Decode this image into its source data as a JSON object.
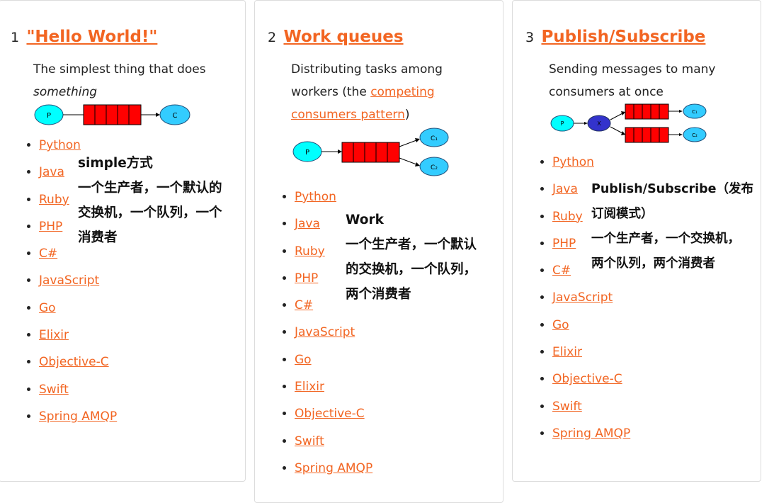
{
  "tutorials": [
    {
      "number": "1",
      "title": "\"Hello World!\"",
      "desc_plain": "The simplest thing that does",
      "desc_em": "something",
      "diagram": {
        "producer": "P",
        "consumer": "C"
      },
      "languages": [
        "Python",
        "Java",
        "Ruby",
        "PHP",
        "C#",
        "JavaScript",
        "Go",
        "Elixir",
        "Objective-C",
        "Swift",
        "Spring AMQP"
      ],
      "note": [
        "simple方式",
        " 一个生产者，一个默认的",
        "交换机，一个队列，一个",
        "消费者"
      ]
    },
    {
      "number": "2",
      "title": "Work queues",
      "desc_plain": "Distributing tasks among workers (the ",
      "desc_link": "competing consumers pattern",
      "desc_tail": ")",
      "diagram": {
        "producer": "P",
        "consumer1": "C₁",
        "consumer2": "C₂"
      },
      "languages": [
        "Python",
        "Java",
        "Ruby",
        "PHP",
        "C#",
        "JavaScript",
        "Go",
        "Elixir",
        "Objective-C",
        "Swift",
        "Spring AMQP"
      ],
      "note": [
        " Work",
        " 一个生产者，一个默认",
        "的交换机，一个队列，",
        "两个消费者"
      ]
    },
    {
      "number": "3",
      "title": "Publish/Subscribe",
      "desc_plain": "Sending messages to many consumers at once",
      "diagram": {
        "producer": "P",
        "exchange": "X",
        "consumer1": "C₁",
        "consumer2": "C₂"
      },
      "languages": [
        "Python",
        "Java",
        "Ruby",
        "PHP",
        "C#",
        "JavaScript",
        "Go",
        "Elixir",
        "Objective-C",
        "Swift",
        "Spring AMQP"
      ],
      "note": [
        "Publish/Subscribe（发布",
        "订阅模式）",
        "一个生产者，一个交换机，",
        "两个队列，两个消费者"
      ]
    }
  ],
  "colors": {
    "link": "#f26522",
    "producer": "#00ffff",
    "consumer": "#33ccff",
    "queue": "#ff0000",
    "exchange": "#3333cc"
  }
}
